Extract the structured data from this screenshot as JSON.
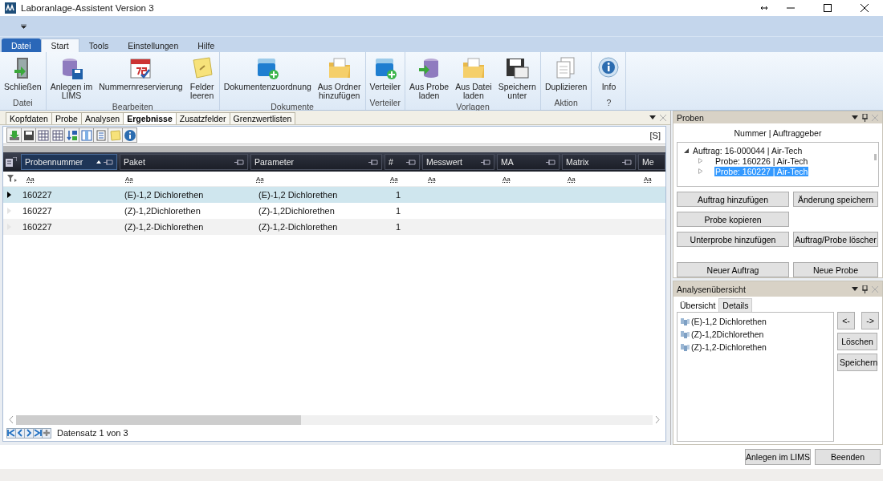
{
  "window": {
    "title": "Laboranlage-Assistent Version 3"
  },
  "ribbon": {
    "tabs": [
      {
        "label": "Datei",
        "kind": "file",
        "selected": false
      },
      {
        "label": "Start",
        "kind": "tab",
        "selected": true
      },
      {
        "label": "Tools",
        "kind": "tab",
        "selected": false
      },
      {
        "label": "Einstellungen",
        "kind": "tab",
        "selected": false
      },
      {
        "label": "Hilfe",
        "kind": "tab",
        "selected": false
      }
    ],
    "groups": [
      {
        "name": "Datei",
        "buttons": [
          {
            "lines": [
              "Schließen"
            ]
          }
        ]
      },
      {
        "name": "Bearbeiten",
        "buttons": [
          {
            "lines": [
              "Anlegen im",
              "LIMS"
            ]
          },
          {
            "lines": [
              "Nummernreservierung"
            ]
          },
          {
            "lines": [
              "Felder",
              "leeren"
            ]
          }
        ]
      },
      {
        "name": "Dokumente",
        "buttons": [
          {
            "lines": [
              "Dokumentenzuordnung"
            ]
          },
          {
            "lines": [
              "Aus Ordner",
              "hinzufügen"
            ]
          }
        ]
      },
      {
        "name": "Verteiler",
        "buttons": [
          {
            "lines": [
              "Verteiler"
            ]
          }
        ]
      },
      {
        "name": "Vorlagen",
        "buttons": [
          {
            "lines": [
              "Aus Probe",
              "laden"
            ]
          },
          {
            "lines": [
              "Aus Datei",
              "laden"
            ]
          },
          {
            "lines": [
              "Speichern",
              "unter"
            ]
          }
        ]
      },
      {
        "name": "Aktion",
        "buttons": [
          {
            "lines": [
              "Duplizieren"
            ]
          }
        ]
      },
      {
        "name": "?",
        "buttons": [
          {
            "lines": [
              "Info"
            ]
          }
        ]
      }
    ]
  },
  "document_tabs": [
    {
      "label": "Kopfdaten",
      "selected": false
    },
    {
      "label": "Probe",
      "selected": false
    },
    {
      "label": "Analysen",
      "selected": false
    },
    {
      "label": "Ergebnisse",
      "selected": true
    },
    {
      "label": "Zusatzfelder",
      "selected": false
    },
    {
      "label": "Grenzwertlisten",
      "selected": false
    }
  ],
  "grid": {
    "toolbar_text": "[S]",
    "columns": [
      {
        "label": "Probennummer",
        "sorted": true
      },
      {
        "label": "Paket",
        "sorted": false
      },
      {
        "label": "Parameter",
        "sorted": false
      },
      {
        "label": "#",
        "sorted": false
      },
      {
        "label": "Messwert",
        "sorted": false
      },
      {
        "label": "MA",
        "sorted": false
      },
      {
        "label": "Matrix",
        "sorted": false
      },
      {
        "label": "Me",
        "sorted": false
      }
    ],
    "filters": [
      "Aa",
      "Aa",
      "Aa",
      "Aa",
      "Aa",
      "Aa",
      "Aa",
      "Aa"
    ],
    "rows": [
      {
        "selected": true,
        "cells": [
          "160227",
          "(E)-1,2 Dichlorethen",
          "(E)-1,2 Dichlorethen",
          "1"
        ]
      },
      {
        "selected": false,
        "cells": [
          "160227",
          "(Z)-1,2Dichlorethen",
          "(Z)-1,2Dichlorethen",
          "1"
        ]
      },
      {
        "selected": false,
        "cells": [
          "160227",
          "(Z)-1,2-Dichlorethen",
          "(Z)-1,2-Dichlorethen",
          "1"
        ]
      }
    ],
    "record_text": "Datensatz 1 von 3"
  },
  "proben_panel": {
    "title": "Proben",
    "heading": "Nummer | Auftraggeber",
    "tree": [
      {
        "label": "Auftrag: 16-000044 | Air-Tech",
        "expanded": true,
        "selected": false,
        "children": [
          {
            "label": "Probe: 160226 | Air-Tech",
            "expanded": false,
            "selected": false
          },
          {
            "label": "Probe: 160227 | Air-Tech",
            "expanded": false,
            "selected": true
          }
        ]
      }
    ],
    "buttons": [
      "Auftrag hinzufügen",
      "Änderung speichern",
      "Probe kopieren",
      "Unterprobe hinzufügen",
      "Auftrag/Probe löscher",
      "Neuer Auftrag",
      "Neue Probe"
    ]
  },
  "analysen_panel": {
    "title": "Analysenübersicht",
    "tabs": [
      {
        "label": "Übersicht",
        "selected": true
      },
      {
        "label": "Details",
        "selected": false
      }
    ],
    "items": [
      "(E)-1,2 Dichlorethen",
      "(Z)-1,2Dichlorethen",
      "(Z)-1,2-Dichlorethen"
    ],
    "arrow_buttons": [
      "<-",
      "->"
    ],
    "buttons": [
      "Löschen",
      "Speichern"
    ]
  },
  "footer_buttons": [
    "Anlegen im LIMS",
    "Beenden"
  ]
}
